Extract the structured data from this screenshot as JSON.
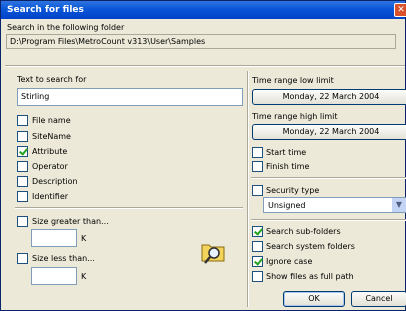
{
  "window": {
    "title": "Search for files"
  },
  "folder": {
    "label": "Search in the following folder",
    "path": "D:\\Program Files\\MetroCount v313\\User\\Samples"
  },
  "text_search": {
    "label": "Text to search for",
    "value": "Stirling"
  },
  "fields": [
    {
      "label": "File name",
      "checked": false
    },
    {
      "label": "SiteName",
      "checked": false
    },
    {
      "label": "Attribute",
      "checked": true
    },
    {
      "label": "Operator",
      "checked": false
    },
    {
      "label": "Description",
      "checked": false
    },
    {
      "label": "Identifier",
      "checked": false
    }
  ],
  "size_greater": {
    "label": "Size greater than...",
    "unit": "K",
    "value": ""
  },
  "size_less": {
    "label": "Size less than...",
    "unit": "K",
    "value": ""
  },
  "time_low": {
    "label": "Time range low limit",
    "value": "Monday, 22 March 2004"
  },
  "time_high": {
    "label": "Time range high limit",
    "value": "Monday, 22 March 2004"
  },
  "time_options": [
    {
      "label": "Start time",
      "checked": false
    },
    {
      "label": "Finish time",
      "checked": false
    }
  ],
  "security": {
    "label": "Security type",
    "value": "Unsigned",
    "checked": false
  },
  "search_options": [
    {
      "label": "Search sub-folders",
      "checked": true
    },
    {
      "label": "Search system folders",
      "checked": false
    },
    {
      "label": "Ignore case",
      "checked": true
    },
    {
      "label": "Show files as full path",
      "checked": false
    }
  ],
  "buttons": {
    "ok": "OK",
    "cancel": "Cancel"
  },
  "icons": {
    "search": "magnifier-folder-icon",
    "close": "close-icon"
  }
}
